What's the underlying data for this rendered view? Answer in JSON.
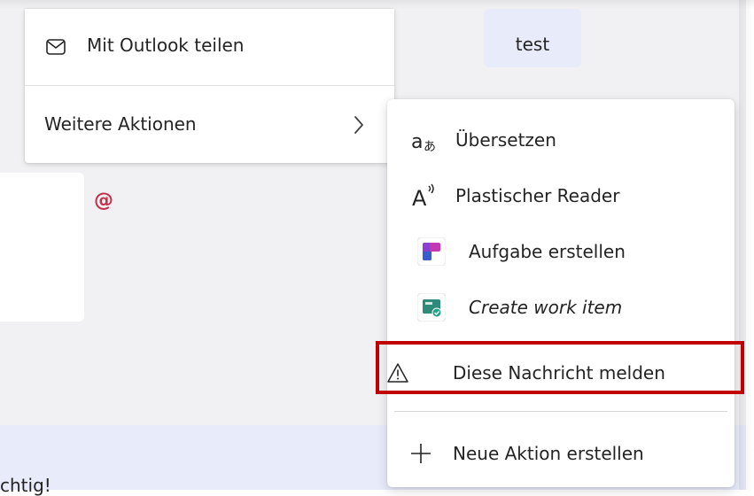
{
  "background": {
    "bubble_text": "test",
    "mention_symbol": "@",
    "partial_message_text": "chtig!"
  },
  "primary_menu": {
    "items": [
      {
        "label": "Mit Outlook teilen",
        "icon": "mail-icon"
      },
      {
        "label": "Weitere Aktionen",
        "icon": "chevron-right-icon"
      }
    ]
  },
  "more_actions_menu": {
    "items": [
      {
        "label": "Übersetzen",
        "icon": "translate-icon"
      },
      {
        "label": "Plastischer Reader",
        "icon": "immersive-reader-icon"
      },
      {
        "label": "Aufgabe erstellen",
        "icon": "planner-app-icon"
      },
      {
        "label": "Create work item",
        "icon": "work-item-app-icon"
      },
      {
        "label": "Diese Nachricht melden",
        "icon": "warning-icon"
      },
      {
        "label": "Neue Aktion erstellen",
        "icon": "plus-icon"
      }
    ],
    "highlighted_item": "Diese Nachricht melden"
  },
  "colors": {
    "highlight_border": "#c00000",
    "mention": "#c4314b",
    "bubble_bg": "#e8ebfa",
    "surface_bg": "#f1f1f3"
  }
}
